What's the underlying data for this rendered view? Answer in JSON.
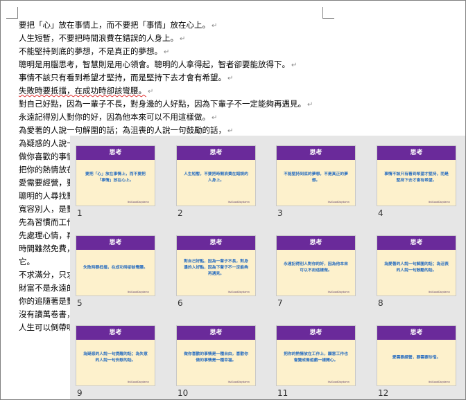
{
  "document": {
    "lines": [
      "要把「心」放在事情上，而不要把「事情」放在心上。",
      "人生短暫，不要把時間浪費在錯誤的人身上。",
      "不能堅持到底的夢想，不是真正的夢想。",
      "聰明是用腦思考，智慧則是用心領會。聰明的人拿得起，智者卻要能放得下。",
      "事情不該只有看到希望才堅持，而是堅持下去才會有希望。",
      "失敗時要抵擋，在成功時卻該彎腰。",
      "對自己好點，因為一輩子不長，對身邊的人好點，因為下輩子不一定能夠再遇見。",
      "永遠記得別人對你的好，因為他本來可以不用這樣做。",
      "為愛著的人說一句解圍的話；為沮喪的人說一句鼓勵的話，",
      "為疑惑的人說一",
      "做你喜歡的事情",
      "把你的熱情放在",
      "愛需要經營，要",
      "聰明的人尋找對",
      "寬容別人，是對",
      "先為習慣而工作",
      "先處理心情，再",
      "時間雖然免費，",
      "它。",
      "不求滿分，只求",
      "財富不是永遠的",
      "你的追隨著是對",
      "沒有讀萬卷書，",
      "人生可以倒帶嗎"
    ]
  },
  "slides": [
    {
      "number": "1",
      "title": "思考",
      "text": "要把「心」放在事情上，而不要把「事情」放在心上。",
      "footer": "ItsiGoodDaydamn"
    },
    {
      "number": "2",
      "title": "思考",
      "text": "人生短暫，不要把時間浪費在錯誤的人身上。",
      "footer": "ItsiGoodDaydamn"
    },
    {
      "number": "3",
      "title": "思考",
      "text": "不能堅持到底的夢想，不是真正的夢想。",
      "footer": "ItsiGoodDaydamn"
    },
    {
      "number": "4",
      "title": "思考",
      "text": "事情不該只有看到希望才堅持，而是堅持下去才會有希望。",
      "footer": "ItsiGoodDaydamn"
    },
    {
      "number": "5",
      "title": "思考",
      "text": "失敗時要抵擋，在成功時卻該彎腰。",
      "footer": "ItsiGoodDaydamn"
    },
    {
      "number": "6",
      "title": "思考",
      "text": "對自己好點，因為一輩子不長，對身邊的人好點，因為下輩子不一定能夠再遇見。",
      "footer": "ItsiGoodDaydamn"
    },
    {
      "number": "7",
      "title": "思考",
      "text": "永遠記得別人對你的好，因為他本來可以不用這樣做。",
      "footer": "ItsiGoodDaydamn"
    },
    {
      "number": "8",
      "title": "思考",
      "text": "為愛著的人說一句解圍的話；為沮喪的人說一句鼓勵的話。",
      "footer": "ItsiGoodDaydamn"
    },
    {
      "number": "9",
      "title": "思考",
      "text": "為疑惑的人說一句提醒的話；為失意的人說一句安慰的話。",
      "footer": "ItsiGoodDaydamn"
    },
    {
      "number": "10",
      "title": "思考",
      "text": "做你喜歡的事情是一種自由，喜歡你做的事情是一種幸福。",
      "footer": "ItsiGoodDaydamn"
    },
    {
      "number": "11",
      "title": "思考",
      "text": "把你的熱情放在工作上，願意工作也會變成像遊戲一樣開心。",
      "footer": "ItsiGoodDaydamn"
    },
    {
      "number": "12",
      "title": "思考",
      "text": "愛需要經營，要需要珍惜。",
      "footer": "ItsiGoodDaydamn"
    }
  ],
  "colors": {
    "slide_header": "#6a2a9a",
    "slide_background": "#fdf1cc",
    "slide_text": "#2b6fc0",
    "sorter_background": "#e6e6e6"
  }
}
